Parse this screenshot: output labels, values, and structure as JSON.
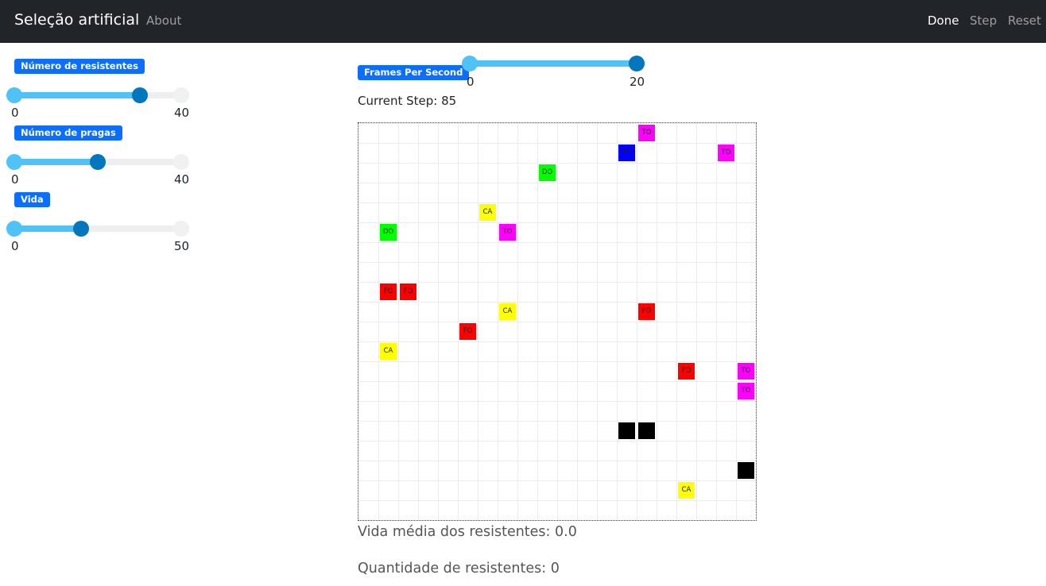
{
  "navbar": {
    "brand": "Seleção artificial",
    "about": "About",
    "done": "Done",
    "step": "Step",
    "reset": "Reset"
  },
  "sidebar": {
    "sliders": [
      {
        "label": "Número de resistentes",
        "min": 0,
        "max": 40,
        "value_fraction": 0.75,
        "min_label": "0",
        "max_label": "40"
      },
      {
        "label": "Número de pragas",
        "min": 0,
        "max": 40,
        "value_fraction": 0.5,
        "min_label": "0",
        "max_label": "40"
      },
      {
        "label": "Vida",
        "min": 0,
        "max": 50,
        "value_fraction": 0.4,
        "min_label": "0",
        "max_label": "50"
      }
    ]
  },
  "fps": {
    "label": "Frames Per Second",
    "min_label": "0",
    "max_label": "20",
    "value_fraction": 1.0
  },
  "current_step": "Current Step: 85",
  "grid": {
    "rows": 20,
    "cols": 20,
    "agents": [
      {
        "row": 0,
        "col": 14,
        "label": "TO",
        "color": "#ff00ff"
      },
      {
        "row": 1,
        "col": 13,
        "label": "RA",
        "color": "#0000ff"
      },
      {
        "row": 1,
        "col": 18,
        "label": "TO",
        "color": "#ff00ff"
      },
      {
        "row": 2,
        "col": 9,
        "label": "DO",
        "color": "#00ff00"
      },
      {
        "row": 4,
        "col": 6,
        "label": "CA",
        "color": "#ffff00"
      },
      {
        "row": 5,
        "col": 1,
        "label": "DO",
        "color": "#00ff00"
      },
      {
        "row": 5,
        "col": 7,
        "label": "TO",
        "color": "#ff00ff"
      },
      {
        "row": 8,
        "col": 1,
        "label": "FO",
        "color": "#ff0000"
      },
      {
        "row": 8,
        "col": 2,
        "label": "FO",
        "color": "#ff0000"
      },
      {
        "row": 9,
        "col": 7,
        "label": "CA",
        "color": "#ffff00"
      },
      {
        "row": 9,
        "col": 14,
        "label": "FO",
        "color": "#ff0000"
      },
      {
        "row": 10,
        "col": 5,
        "label": "FO",
        "color": "#ff0000"
      },
      {
        "row": 11,
        "col": 1,
        "label": "CA",
        "color": "#ffff00"
      },
      {
        "row": 12,
        "col": 16,
        "label": "FO",
        "color": "#ff0000"
      },
      {
        "row": 12,
        "col": 19,
        "label": "TO",
        "color": "#ff00ff"
      },
      {
        "row": 13,
        "col": 19,
        "label": "TO",
        "color": "#ff00ff"
      },
      {
        "row": 15,
        "col": 13,
        "label": "",
        "color": "#000000"
      },
      {
        "row": 15,
        "col": 14,
        "label": "",
        "color": "#000000"
      },
      {
        "row": 17,
        "col": 19,
        "label": "",
        "color": "#000000"
      },
      {
        "row": 18,
        "col": 16,
        "label": "CA",
        "color": "#ffff00"
      }
    ]
  },
  "stats": {
    "vida_media": "Vida média dos resistentes: 0.0",
    "quantidade": "Quantidade de resistentes: 0"
  }
}
